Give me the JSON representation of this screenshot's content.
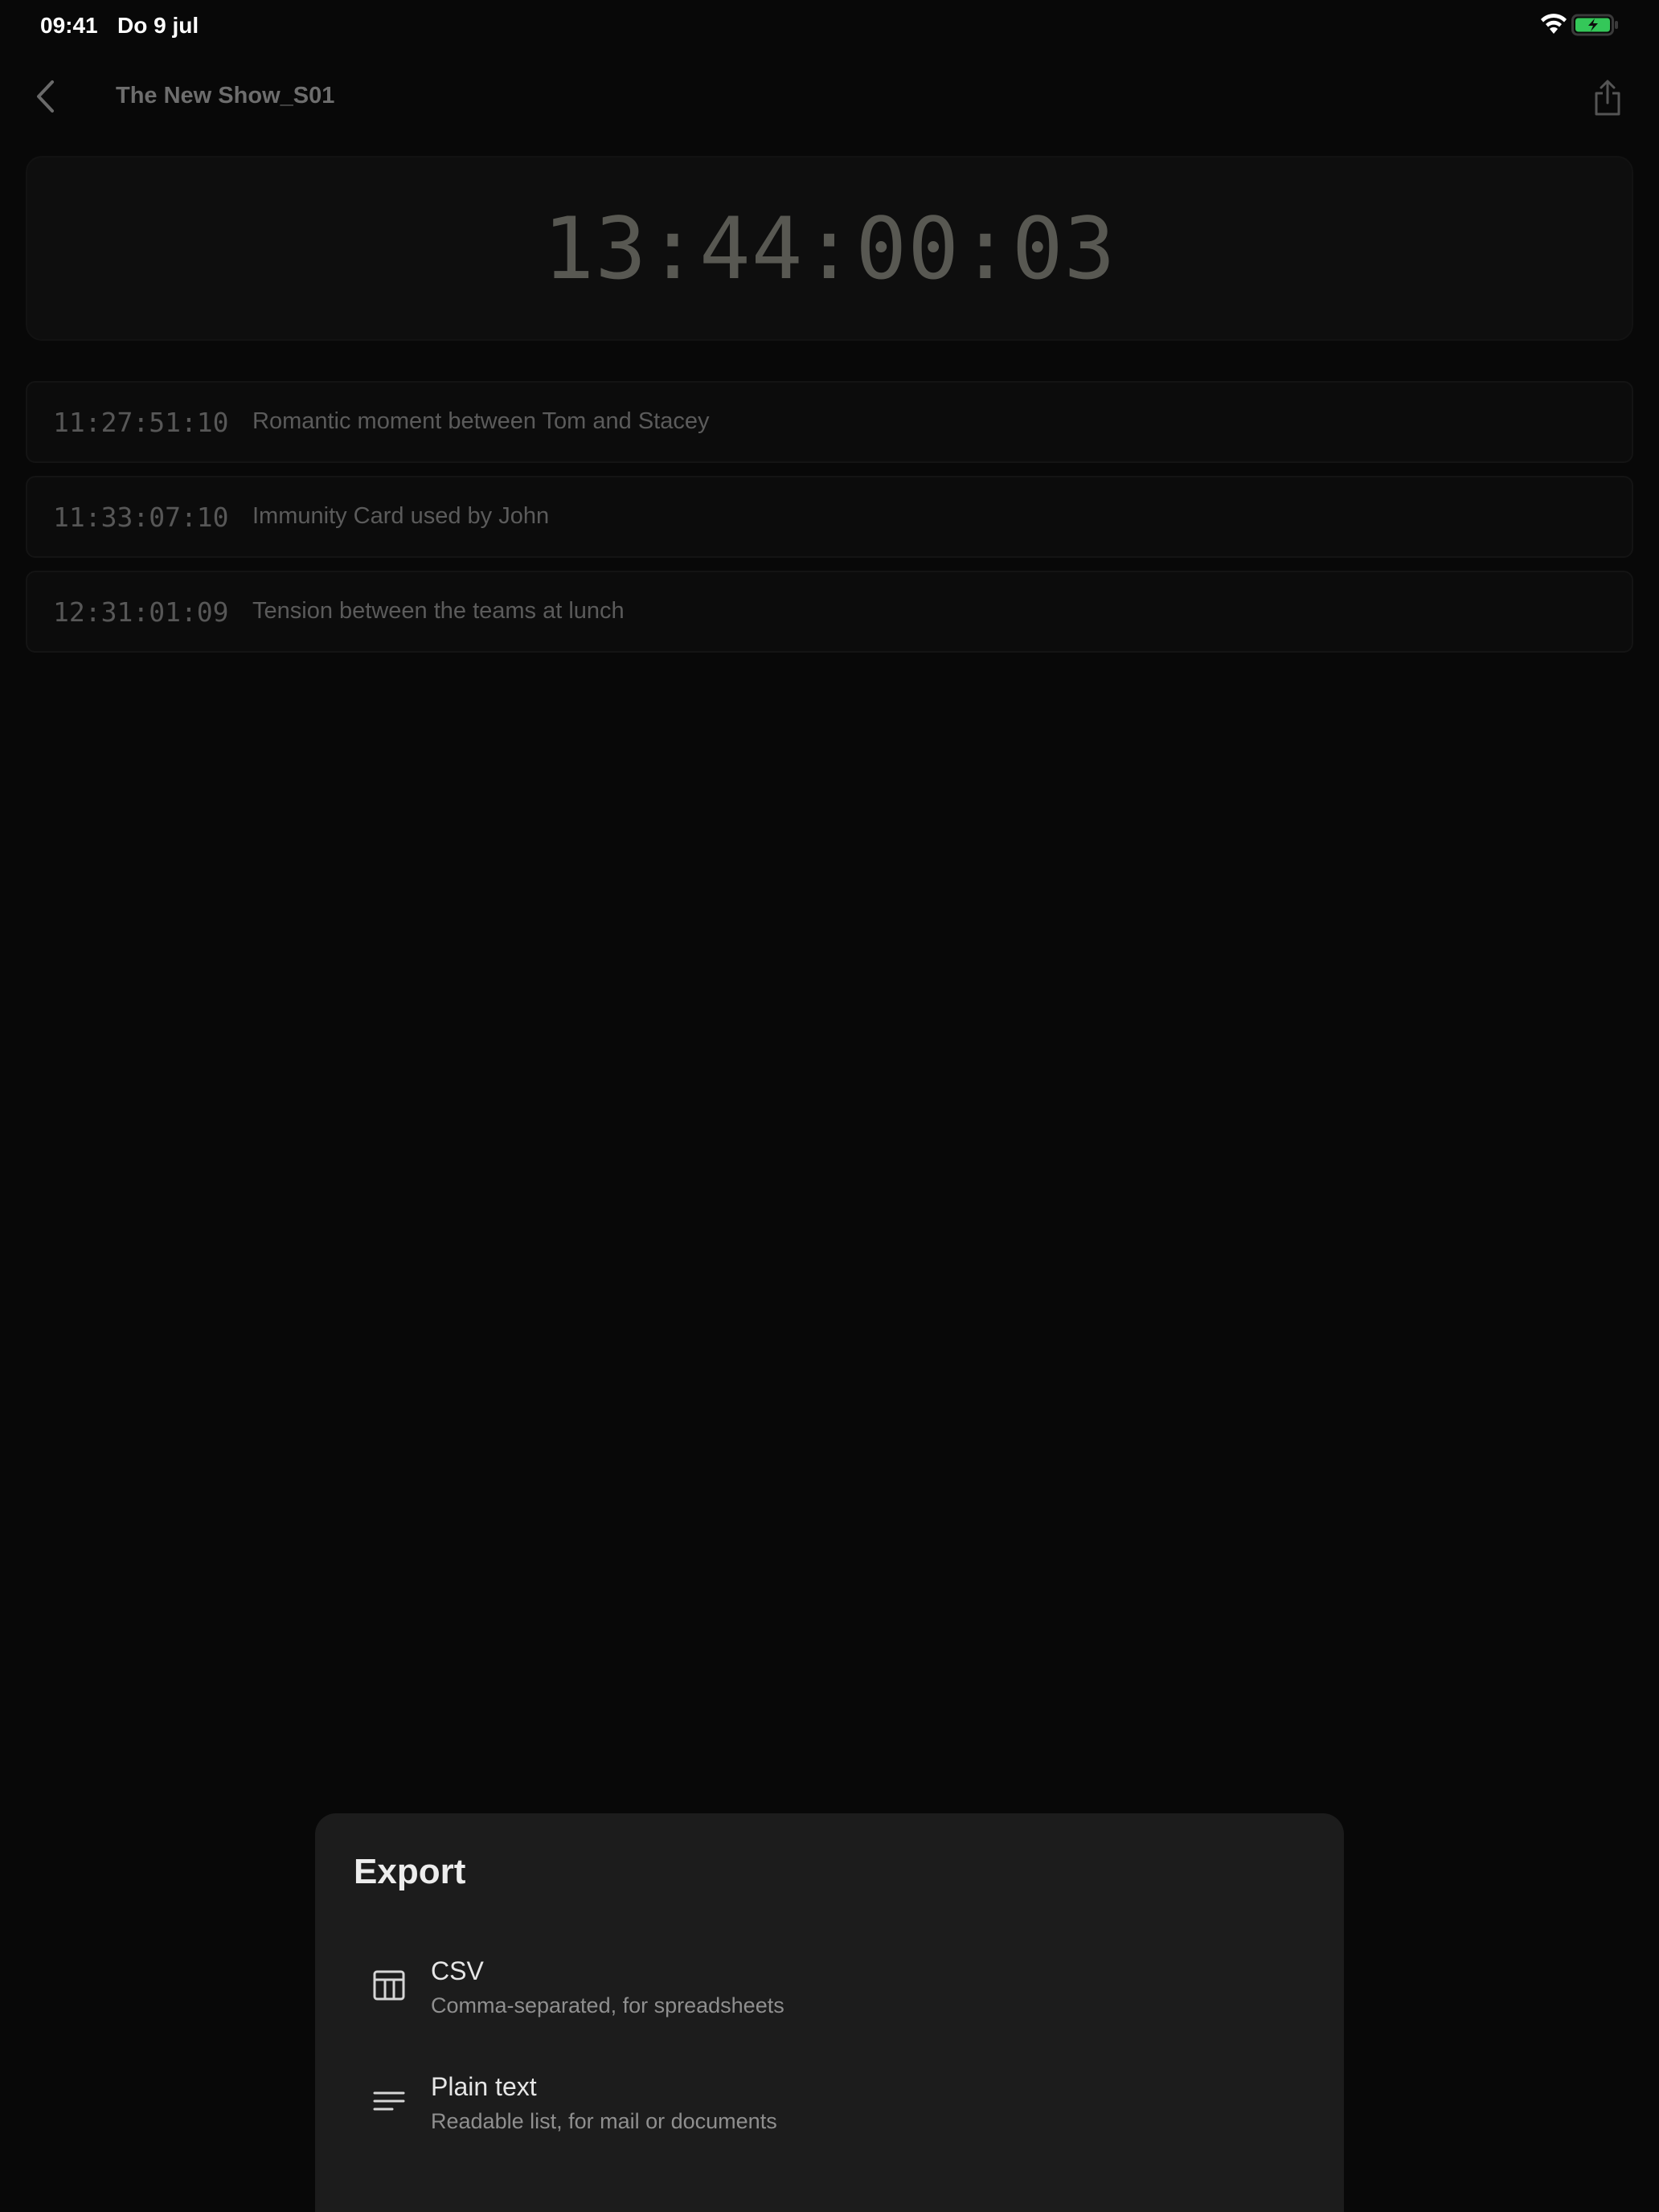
{
  "status_bar": {
    "time": "09:41",
    "date": "Do 9 jul"
  },
  "nav": {
    "title": "The New Show_S01",
    "back_icon": "chevron-left-icon",
    "share_icon": "share-icon"
  },
  "timecode": {
    "current": "13:44:00:03"
  },
  "markers": [
    {
      "timecode": "11:27:51:10",
      "description": "Romantic moment between Tom and Stacey"
    },
    {
      "timecode": "11:33:07:10",
      "description": "Immunity Card used by John"
    },
    {
      "timecode": "12:31:01:09",
      "description": "Tension between the teams at lunch"
    }
  ],
  "export": {
    "title": "Export",
    "options": [
      {
        "label": "CSV",
        "description": "Comma-separated, for spreadsheets",
        "icon": "table-icon"
      },
      {
        "label": "Plain text",
        "description": "Readable list, for mail or documents",
        "icon": "lines-icon"
      }
    ]
  },
  "colors": {
    "background": "#080808",
    "sheet": "#1c1c1c",
    "battery_green": "#34c759"
  }
}
